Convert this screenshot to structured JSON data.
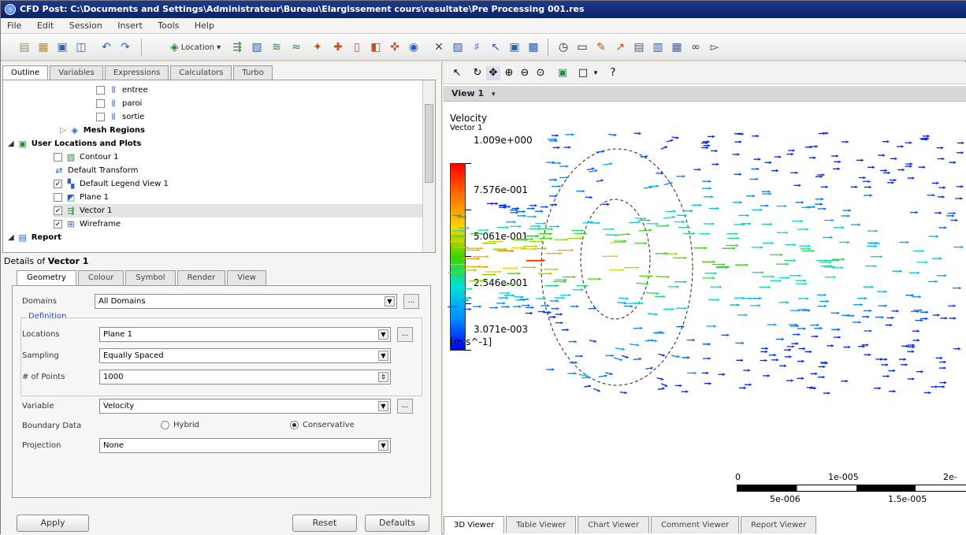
{
  "window": {
    "title": "CFD Post: C:\\Documents and Settings\\Administrateur\\Bureau\\Elargissement cours\\resultate\\Pre Processing 001.res"
  },
  "menu": [
    "File",
    "Edit",
    "Session",
    "Insert",
    "Tools",
    "Help"
  ],
  "toolbar": {
    "location_label": "Location"
  },
  "outline_tabs": [
    "Outline",
    "Variables",
    "Expressions",
    "Calculators",
    "Turbo"
  ],
  "tree": {
    "items": [
      {
        "label": "entree",
        "checked": false,
        "level": 3
      },
      {
        "label": "paroi",
        "checked": false,
        "level": 3
      },
      {
        "label": "sortie",
        "checked": false,
        "level": 3
      },
      {
        "label": "Mesh Regions",
        "checked": null,
        "level": 2
      },
      {
        "label": "User Locations and Plots",
        "checked": null,
        "level": 0
      },
      {
        "label": "Contour 1",
        "checked": false,
        "level": 1
      },
      {
        "label": "Default Transform",
        "checked": null,
        "level": 1
      },
      {
        "label": "Default Legend View 1",
        "checked": true,
        "level": 1
      },
      {
        "label": "Plane 1",
        "checked": false,
        "level": 1
      },
      {
        "label": "Vector 1",
        "checked": true,
        "level": 1
      },
      {
        "label": "Wireframe",
        "checked": true,
        "level": 1
      },
      {
        "label": "Report",
        "checked": null,
        "level": 0
      }
    ]
  },
  "details": {
    "title_prefix": "Details of ",
    "title_object": "Vector 1",
    "tabs": [
      "Geometry",
      "Colour",
      "Symbol",
      "Render",
      "View"
    ],
    "domains_label": "Domains",
    "domains_value": "All Domains",
    "definition_label": "Definition",
    "locations_label": "Locations",
    "locations_value": "Plane 1",
    "sampling_label": "Sampling",
    "sampling_value": "Equally Spaced",
    "points_label": "# of Points",
    "points_value": "1000",
    "variable_label": "Variable",
    "variable_value": "Velocity",
    "boundary_label": "Boundary Data",
    "boundary_opt1": "Hybrid",
    "boundary_opt2": "Conservative",
    "boundary_selected": "Conservative",
    "projection_label": "Projection",
    "projection_value": "None",
    "ellipsis": "...",
    "apply": "Apply",
    "reset": "Reset",
    "defaults": "Defaults"
  },
  "viewer": {
    "view_label": "View 1",
    "legend_title": "Velocity",
    "legend_sub": "Vector 1",
    "legend_ticks": [
      "1.009e+000",
      "7.576e-001",
      "5.061e-001",
      "2.546e-001",
      "3.071e-003"
    ],
    "legend_unit": "[m s^-1]",
    "scale_labels_top": [
      "0",
      "1e-005",
      "2e-"
    ],
    "scale_labels_bottom": [
      "5e-006",
      "1.5e-005"
    ],
    "colors": {
      "max": "#ff0000",
      "min": "#0000ff"
    }
  },
  "bottom_tabs": [
    "3D Viewer",
    "Table Viewer",
    "Chart Viewer",
    "Comment Viewer",
    "Report Viewer"
  ]
}
